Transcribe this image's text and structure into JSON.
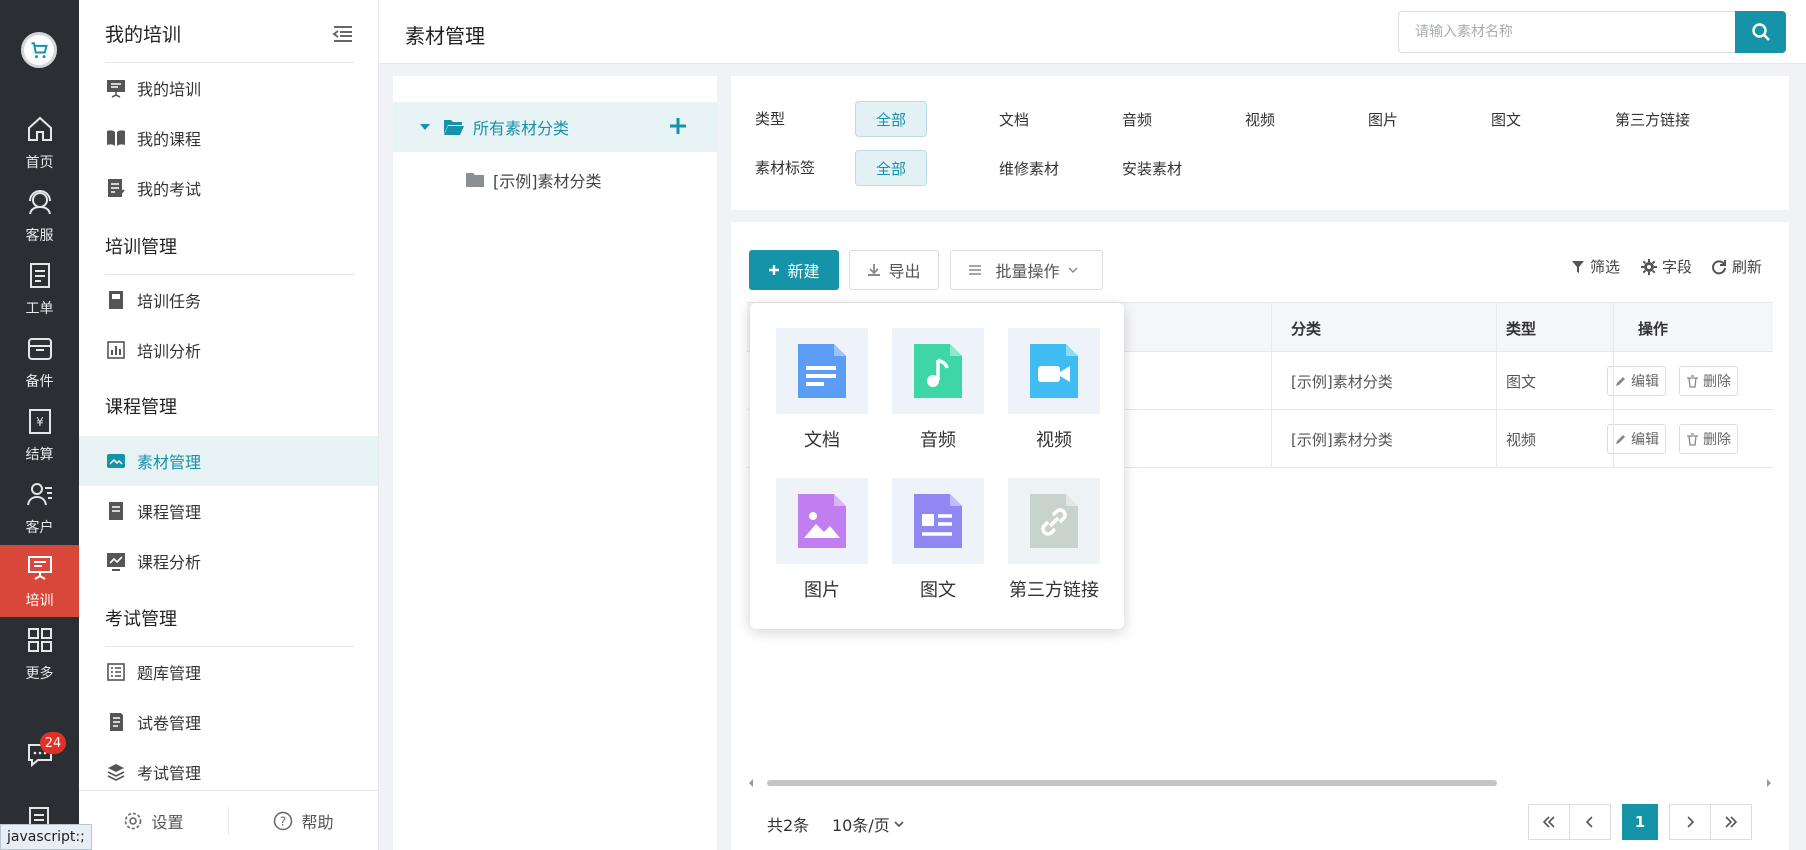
{
  "rail": {
    "items": [
      {
        "label": "首页",
        "icon": "home-icon"
      },
      {
        "label": "客服",
        "icon": "headset-icon"
      },
      {
        "label": "工单",
        "icon": "clipboard-icon"
      },
      {
        "label": "备件",
        "icon": "box-icon"
      },
      {
        "label": "结算",
        "icon": "receipt-icon"
      },
      {
        "label": "客户",
        "icon": "user-list-icon"
      },
      {
        "label": "培训",
        "icon": "presentation-icon"
      },
      {
        "label": "更多",
        "icon": "grid-icon"
      }
    ],
    "active": "培训",
    "message_badge": "24",
    "active_color": "#d9473a"
  },
  "menu": {
    "title": "我的培训",
    "groups": {
      "training_mgmt": "培训管理",
      "course_mgmt": "课程管理",
      "exam_mgmt": "考试管理"
    },
    "items": {
      "my_training": "我的培训",
      "my_courses": "我的课程",
      "my_exams": "我的考试",
      "training_tasks": "培训任务",
      "training_analysis": "培训分析",
      "material_mgmt": "素材管理",
      "course_manage": "课程管理",
      "course_analysis": "课程分析",
      "question_bank": "题库管理",
      "paper_mgmt": "试卷管理",
      "exam_manage": "考试管理"
    },
    "footer": {
      "settings": "设置",
      "help": "帮助"
    }
  },
  "status_tip": "javascript:;",
  "header": {
    "title": "素材管理",
    "search_placeholder": "请输入素材名称",
    "accent": "#1593a8"
  },
  "tree": {
    "root": "所有素材分类",
    "children": [
      "[示例]素材分类"
    ]
  },
  "filters": {
    "type_label": "类型",
    "type_options": [
      "全部",
      "文档",
      "音频",
      "视频",
      "图片",
      "图文",
      "第三方链接"
    ],
    "tag_label": "素材标签",
    "tag_options": [
      "全部",
      "维修素材",
      "安装素材"
    ]
  },
  "toolbar": {
    "new": "新建",
    "export": "导出",
    "batch": "批量操作",
    "filter": "筛选",
    "fields": "字段",
    "refresh": "刷新"
  },
  "table": {
    "headers": {
      "category": "分类",
      "type": "类型",
      "action": "操作"
    },
    "rows": [
      {
        "category": "[示例]素材分类",
        "type": "图文"
      },
      {
        "category": "[示例]素材分类",
        "type": "视频"
      }
    ],
    "edit": "编辑",
    "delete": "删除"
  },
  "popup": {
    "items": [
      {
        "label": "文档",
        "icon": "document-icon",
        "color": "#5b9cf5"
      },
      {
        "label": "音频",
        "icon": "audio-icon",
        "color": "#3fd6a7"
      },
      {
        "label": "视频",
        "icon": "video-icon",
        "color": "#3fbcf2"
      },
      {
        "label": "图片",
        "icon": "image-icon",
        "color": "#c07ef0"
      },
      {
        "label": "图文",
        "icon": "article-icon",
        "color": "#8f88f2"
      },
      {
        "label": "第三方链接",
        "icon": "link-icon",
        "color": "#c9d3cd"
      }
    ]
  },
  "pagination": {
    "total": "共2条",
    "page_size": "10条/页",
    "current": "1"
  }
}
